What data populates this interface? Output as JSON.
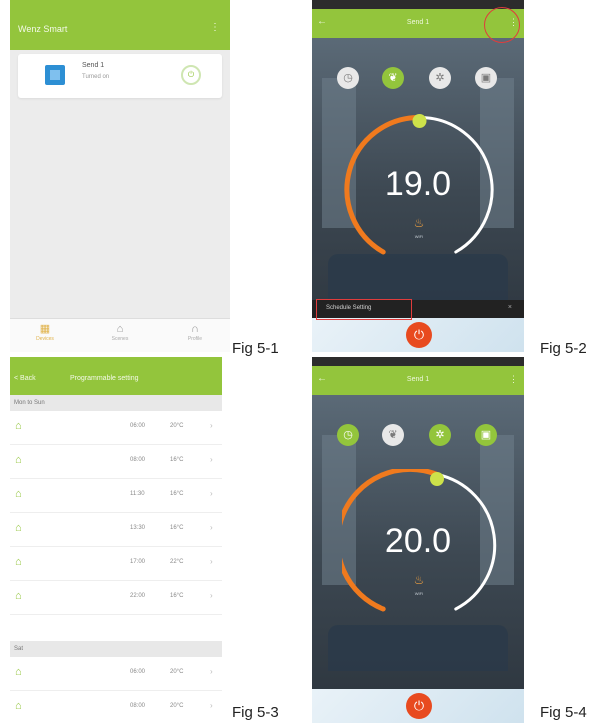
{
  "captions": {
    "fig1": "Fig 5-1",
    "fig2": "Fig 5-2",
    "fig3": "Fig 5-3",
    "fig4": "Fig 5-4"
  },
  "fig1": {
    "app_title": "Wenz Smart",
    "menu_icon": "more-vertical-icon",
    "device": {
      "name": "Send 1",
      "status": "Turned on"
    },
    "tabs": [
      {
        "label": "Devices",
        "icon": "grid-icon",
        "active": true
      },
      {
        "label": "Scenes",
        "icon": "home-icon",
        "active": false
      },
      {
        "label": "Profile",
        "icon": "headset-icon",
        "active": false
      }
    ]
  },
  "fig2": {
    "title": "Send 1",
    "temperature": "19.0",
    "schedule_label": "Schedule Setting",
    "heat_label": "WIFI",
    "modes": [
      "clock-icon",
      "leaf-icon",
      "snowflake-icon",
      "calendar-icon"
    ],
    "active_mode_index": 1,
    "dial_level": 0.42
  },
  "fig3": {
    "back_label": "< Back",
    "title": "Programmable setting",
    "sections": [
      {
        "label": "Mon to Sun",
        "rows": [
          {
            "time": "06:00",
            "value": "20°C"
          },
          {
            "time": "08:00",
            "value": "16°C"
          },
          {
            "time": "11:30",
            "value": "16°C"
          },
          {
            "time": "13:30",
            "value": "16°C"
          },
          {
            "time": "17:00",
            "value": "22°C"
          },
          {
            "time": "22:00",
            "value": "16°C"
          }
        ]
      },
      {
        "label": "Sat",
        "rows": [
          {
            "time": "06:00",
            "value": "20°C"
          },
          {
            "time": "08:00",
            "value": "20°C"
          }
        ]
      }
    ]
  },
  "fig4": {
    "title": "Send 1",
    "temperature": "20.0",
    "heat_label": "WIFI",
    "modes": [
      "clock-icon",
      "leaf-icon",
      "snowflake-icon",
      "calendar-icon"
    ],
    "active_mode_index": 3,
    "dial_level": 0.5
  },
  "colors": {
    "brand_green": "#93c53c",
    "heat_orange": "#f07a1e",
    "power_red": "#e84a1f",
    "highlight_red": "#e03c3c"
  }
}
